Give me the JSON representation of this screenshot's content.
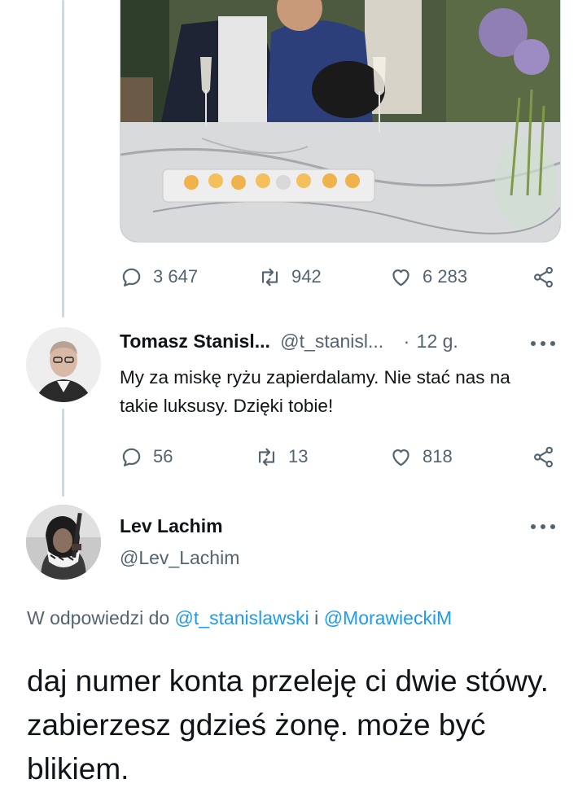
{
  "photo_tweet": {
    "actions": {
      "replies": "3 647",
      "retweets": "942",
      "likes": "6 283"
    }
  },
  "reply_tweet": {
    "display_name": "Tomasz Stanisl...",
    "handle": "@t_stanisl...",
    "separator": "·",
    "time": "12 g.",
    "text": "My za miskę ryżu zapierdalamy. Nie stać nas na takie luksusy. Dzięki tobie!",
    "actions": {
      "replies": "56",
      "retweets": "13",
      "likes": "818"
    }
  },
  "main_tweet": {
    "display_name": "Lev Lachim",
    "handle": "@Lev_Lachim",
    "reply_prefix": "W odpowiedzi do",
    "mention_1": "@t_stanislawski",
    "conjunction": "i",
    "mention_2": "@MorawieckiM",
    "text": "daj numer konta przeleję ci dwie stówy. zabierzesz gdzieś żonę. może być blikiem."
  },
  "icons": [
    "reply-icon",
    "retweet-icon",
    "like-icon",
    "share-icon",
    "more-icon"
  ],
  "colors": {
    "link": "#1d9bf0",
    "secondary_text": "#536471",
    "thread_line": "#cfd9de"
  }
}
